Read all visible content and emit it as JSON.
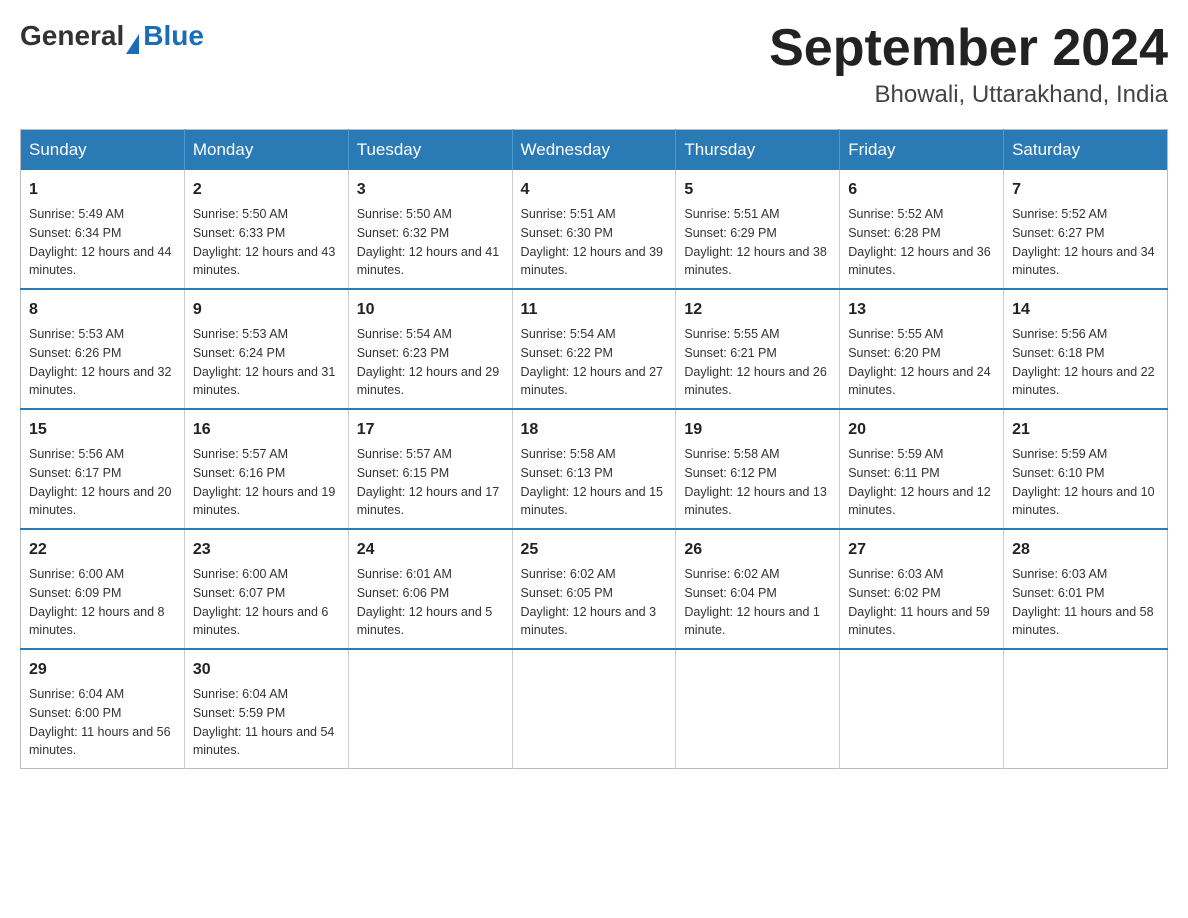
{
  "header": {
    "logo_general": "General",
    "logo_blue": "Blue",
    "month_year": "September 2024",
    "location": "Bhowali, Uttarakhand, India"
  },
  "days_of_week": [
    "Sunday",
    "Monday",
    "Tuesday",
    "Wednesday",
    "Thursday",
    "Friday",
    "Saturday"
  ],
  "weeks": [
    [
      {
        "day": 1,
        "sunrise": "5:49 AM",
        "sunset": "6:34 PM",
        "daylight": "12 hours and 44 minutes."
      },
      {
        "day": 2,
        "sunrise": "5:50 AM",
        "sunset": "6:33 PM",
        "daylight": "12 hours and 43 minutes."
      },
      {
        "day": 3,
        "sunrise": "5:50 AM",
        "sunset": "6:32 PM",
        "daylight": "12 hours and 41 minutes."
      },
      {
        "day": 4,
        "sunrise": "5:51 AM",
        "sunset": "6:30 PM",
        "daylight": "12 hours and 39 minutes."
      },
      {
        "day": 5,
        "sunrise": "5:51 AM",
        "sunset": "6:29 PM",
        "daylight": "12 hours and 38 minutes."
      },
      {
        "day": 6,
        "sunrise": "5:52 AM",
        "sunset": "6:28 PM",
        "daylight": "12 hours and 36 minutes."
      },
      {
        "day": 7,
        "sunrise": "5:52 AM",
        "sunset": "6:27 PM",
        "daylight": "12 hours and 34 minutes."
      }
    ],
    [
      {
        "day": 8,
        "sunrise": "5:53 AM",
        "sunset": "6:26 PM",
        "daylight": "12 hours and 32 minutes."
      },
      {
        "day": 9,
        "sunrise": "5:53 AM",
        "sunset": "6:24 PM",
        "daylight": "12 hours and 31 minutes."
      },
      {
        "day": 10,
        "sunrise": "5:54 AM",
        "sunset": "6:23 PM",
        "daylight": "12 hours and 29 minutes."
      },
      {
        "day": 11,
        "sunrise": "5:54 AM",
        "sunset": "6:22 PM",
        "daylight": "12 hours and 27 minutes."
      },
      {
        "day": 12,
        "sunrise": "5:55 AM",
        "sunset": "6:21 PM",
        "daylight": "12 hours and 26 minutes."
      },
      {
        "day": 13,
        "sunrise": "5:55 AM",
        "sunset": "6:20 PM",
        "daylight": "12 hours and 24 minutes."
      },
      {
        "day": 14,
        "sunrise": "5:56 AM",
        "sunset": "6:18 PM",
        "daylight": "12 hours and 22 minutes."
      }
    ],
    [
      {
        "day": 15,
        "sunrise": "5:56 AM",
        "sunset": "6:17 PM",
        "daylight": "12 hours and 20 minutes."
      },
      {
        "day": 16,
        "sunrise": "5:57 AM",
        "sunset": "6:16 PM",
        "daylight": "12 hours and 19 minutes."
      },
      {
        "day": 17,
        "sunrise": "5:57 AM",
        "sunset": "6:15 PM",
        "daylight": "12 hours and 17 minutes."
      },
      {
        "day": 18,
        "sunrise": "5:58 AM",
        "sunset": "6:13 PM",
        "daylight": "12 hours and 15 minutes."
      },
      {
        "day": 19,
        "sunrise": "5:58 AM",
        "sunset": "6:12 PM",
        "daylight": "12 hours and 13 minutes."
      },
      {
        "day": 20,
        "sunrise": "5:59 AM",
        "sunset": "6:11 PM",
        "daylight": "12 hours and 12 minutes."
      },
      {
        "day": 21,
        "sunrise": "5:59 AM",
        "sunset": "6:10 PM",
        "daylight": "12 hours and 10 minutes."
      }
    ],
    [
      {
        "day": 22,
        "sunrise": "6:00 AM",
        "sunset": "6:09 PM",
        "daylight": "12 hours and 8 minutes."
      },
      {
        "day": 23,
        "sunrise": "6:00 AM",
        "sunset": "6:07 PM",
        "daylight": "12 hours and 6 minutes."
      },
      {
        "day": 24,
        "sunrise": "6:01 AM",
        "sunset": "6:06 PM",
        "daylight": "12 hours and 5 minutes."
      },
      {
        "day": 25,
        "sunrise": "6:02 AM",
        "sunset": "6:05 PM",
        "daylight": "12 hours and 3 minutes."
      },
      {
        "day": 26,
        "sunrise": "6:02 AM",
        "sunset": "6:04 PM",
        "daylight": "12 hours and 1 minute."
      },
      {
        "day": 27,
        "sunrise": "6:03 AM",
        "sunset": "6:02 PM",
        "daylight": "11 hours and 59 minutes."
      },
      {
        "day": 28,
        "sunrise": "6:03 AM",
        "sunset": "6:01 PM",
        "daylight": "11 hours and 58 minutes."
      }
    ],
    [
      {
        "day": 29,
        "sunrise": "6:04 AM",
        "sunset": "6:00 PM",
        "daylight": "11 hours and 56 minutes."
      },
      {
        "day": 30,
        "sunrise": "6:04 AM",
        "sunset": "5:59 PM",
        "daylight": "11 hours and 54 minutes."
      },
      null,
      null,
      null,
      null,
      null
    ]
  ]
}
